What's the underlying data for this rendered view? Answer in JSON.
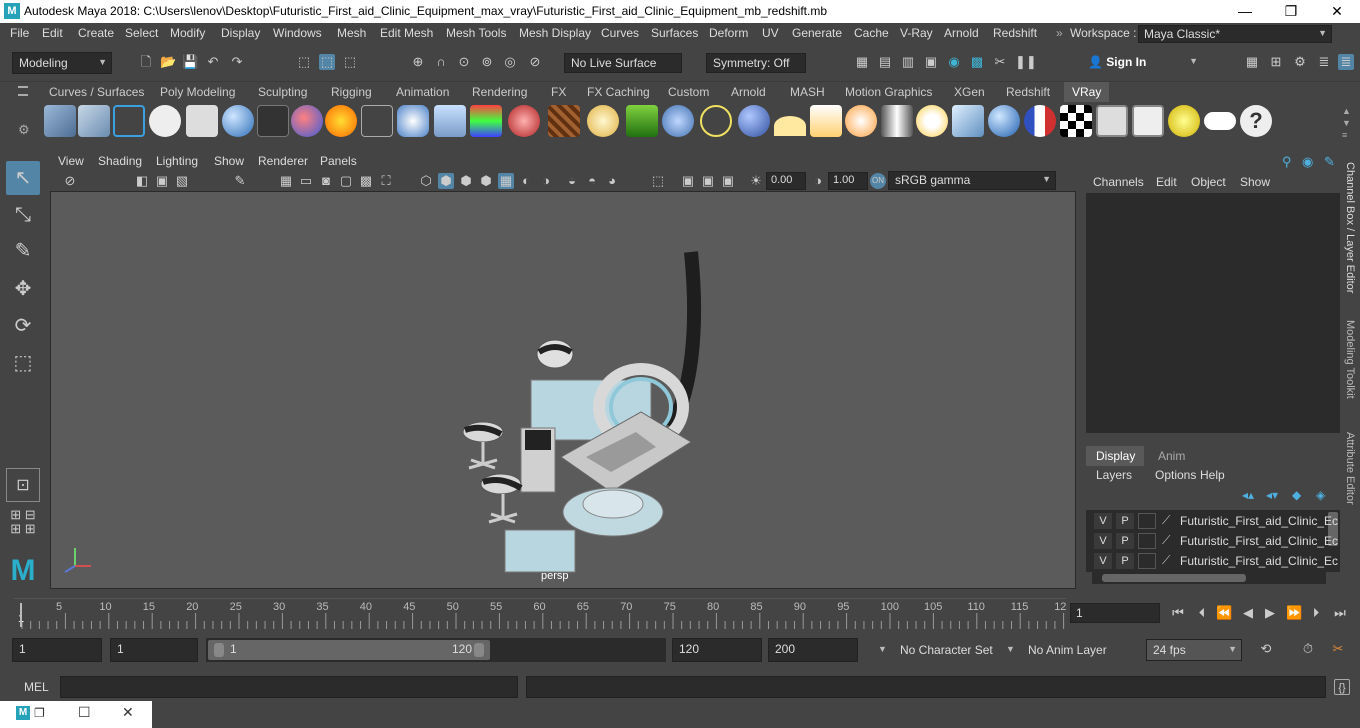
{
  "titlebar": {
    "title": "Autodesk Maya 2018: C:\\Users\\lenov\\Desktop\\Futuristic_First_aid_Clinic_Equipment_max_vray\\Futuristic_First_aid_Clinic_Equipment_mb_redshift.mb",
    "logo": "M",
    "minimize": "—",
    "maximize": "❐",
    "close": "✕"
  },
  "menubar": {
    "items": [
      "File",
      "Edit",
      "Create",
      "Select",
      "Modify",
      "Display",
      "Windows",
      "Mesh",
      "Edit Mesh",
      "Mesh Tools",
      "Mesh Display",
      "Curves",
      "Surfaces",
      "Deform",
      "UV",
      "Generate",
      "Cache",
      "V-Ray",
      "Arnold",
      "Redshift"
    ],
    "workspace_label": "Workspace :",
    "workspace_value": "Maya Classic*"
  },
  "toolbar": {
    "mode": "Modeling",
    "live_surface": "No Live Surface",
    "symmetry": "Symmetry: Off",
    "sign_in": "Sign In"
  },
  "shelf_tabs": [
    "Curves / Surfaces",
    "Poly Modeling",
    "Sculpting",
    "Rigging",
    "Animation",
    "Rendering",
    "FX",
    "FX Caching",
    "Custom",
    "Arnold",
    "MASH",
    "Motion Graphics",
    "XGen",
    "Redshift",
    "VRay"
  ],
  "shelf_active": "VRay",
  "viewport": {
    "menu": [
      "View",
      "Shading",
      "Lighting",
      "Show",
      "Renderer",
      "Panels"
    ],
    "exposure": "0.00",
    "gamma": "1.00",
    "color_space": "sRGB gamma",
    "camera_label": "persp"
  },
  "channel_box": {
    "menu": [
      "Channels",
      "Edit",
      "Object",
      "Show"
    ],
    "tabs": [
      "Display",
      "Anim"
    ],
    "active_tab": "Display",
    "layer_menu": [
      "Layers",
      "Options",
      "Help"
    ],
    "layers": [
      {
        "v": "V",
        "p": "P",
        "name": "Futuristic_First_aid_Clinic_Ec"
      },
      {
        "v": "V",
        "p": "P",
        "name": "Futuristic_First_aid_Clinic_Ec"
      },
      {
        "v": "V",
        "p": "P",
        "name": "Futuristic_First_aid_Clinic_Ec"
      }
    ]
  },
  "right_strip": [
    "Channel Box / Layer Editor",
    "Modeling Toolkit",
    "Attribute Editor"
  ],
  "timeline": {
    "ticks": [
      "5",
      "10",
      "15",
      "20",
      "25",
      "30",
      "35",
      "40",
      "45",
      "50",
      "55",
      "60",
      "65",
      "70",
      "75",
      "80",
      "85",
      "90",
      "95",
      "100",
      "105",
      "110",
      "115",
      "12"
    ],
    "start_marker": "1",
    "current_frame": "1"
  },
  "range": {
    "start": "1",
    "anim_start": "1",
    "slider_start": "1",
    "slider_end": "120",
    "anim_end": "120",
    "end": "200",
    "character_set": "No Character Set",
    "anim_layer": "No Anim Layer",
    "fps": "24 fps"
  },
  "cmd": {
    "label": "MEL"
  },
  "colors": {
    "bg": "#444444",
    "viewport": "#5b5b5b",
    "accent": "#5285a6",
    "field": "#2b2b2b"
  }
}
